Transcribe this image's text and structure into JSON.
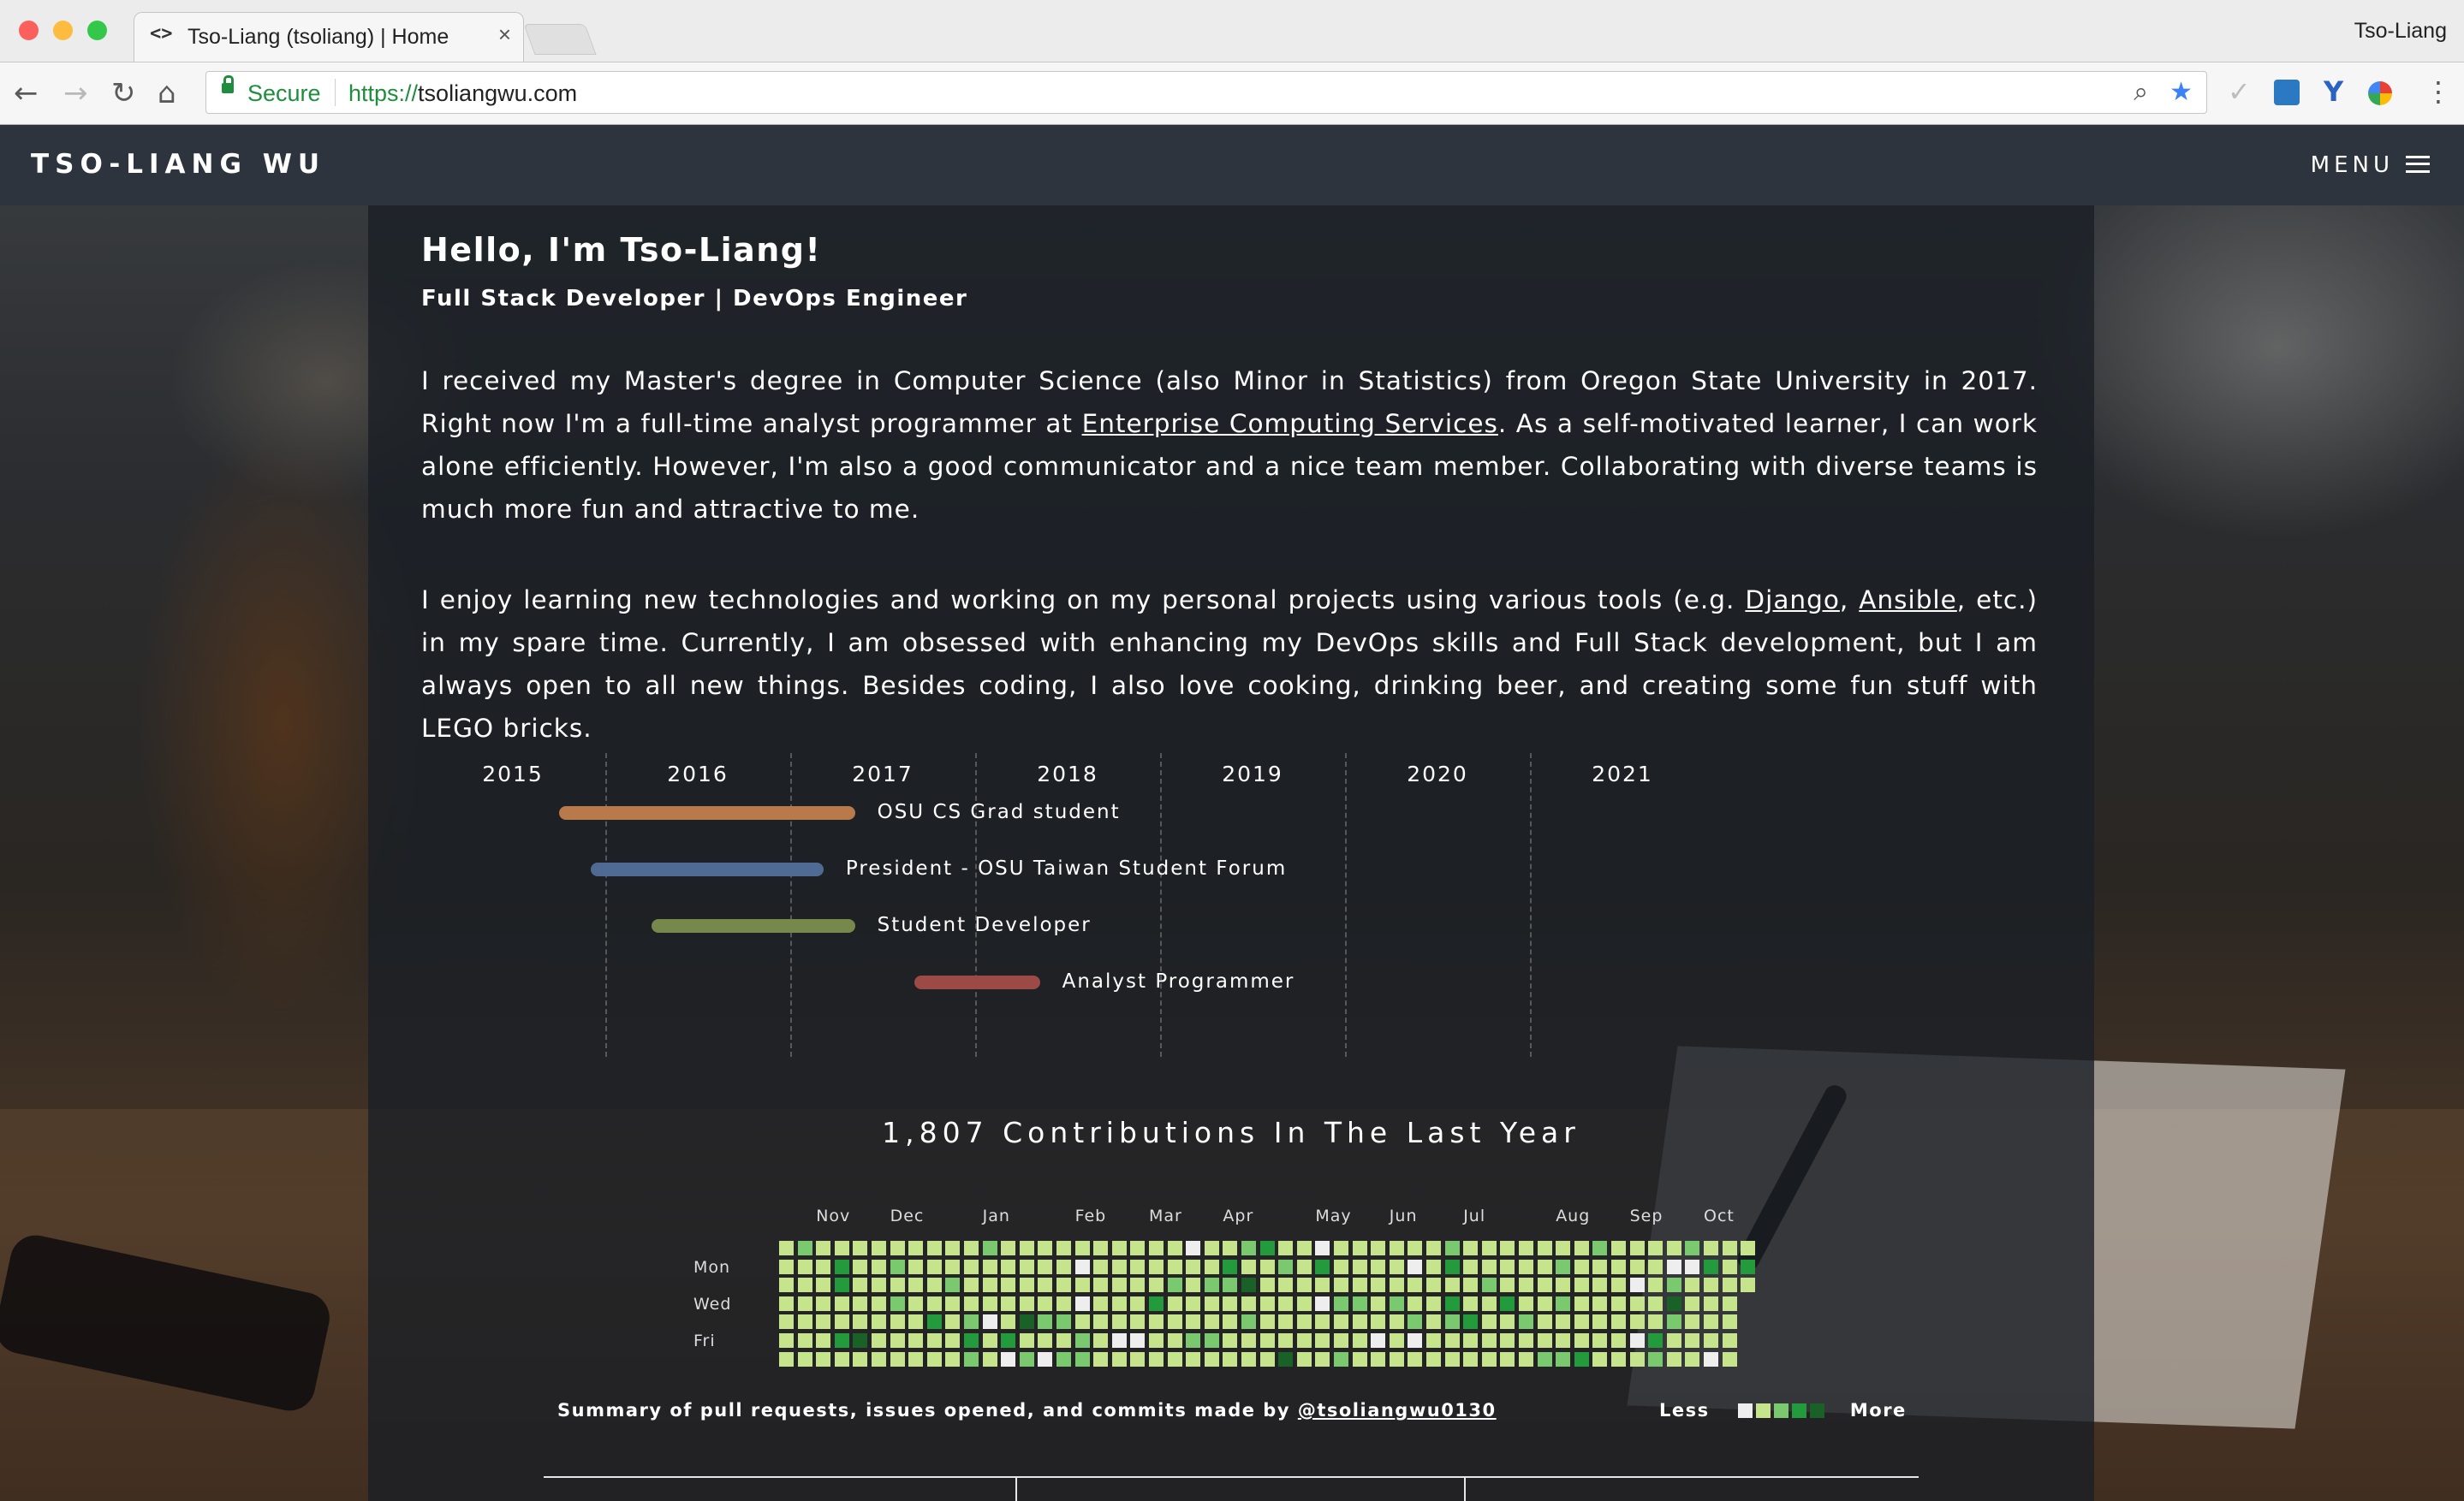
{
  "browser": {
    "tab_title": "Tso-Liang (tsoliang) | Home",
    "tab_icon": "code-icon",
    "tab_close": "×",
    "profile_name": "Tso-Liang",
    "security_label": "Secure",
    "url_scheme": "https://",
    "url_host": "tsoliangwu.com"
  },
  "site": {
    "brand": "TSO-LIANG WU",
    "menu_label": "MENU"
  },
  "hero": {
    "greeting": "Hello, I'm Tso-Liang!",
    "subtitle": "Full Stack Developer | DevOps Engineer"
  },
  "about": {
    "p1_a": "I received my Master's degree in Computer Science (also Minor in Statistics) from Oregon State University in 2017. Right now I'm a full-time analyst programmer at ",
    "p1_link": "Enterprise Computing Services",
    "p1_b": ". As a self-motivated learner, I can work alone efficiently. However, I'm also a good communicator and a nice team member. Collaborating with diverse teams is much more fun and attractive to me.",
    "p2_a": "I enjoy learning new technologies and working on my personal projects using various tools (e.g. ",
    "p2_link1": "Django",
    "p2_sep": ", ",
    "p2_link2": "Ansible",
    "p2_b": ", etc.) in my spare time. Currently, I am obsessed with enhancing my DevOps skills and Full Stack development, but I am always open to all new things. Besides coding, I also love cooking, drinking beer, and creating some fun stuff with LEGO bricks."
  },
  "timeline": {
    "years": [
      "2015",
      "2016",
      "2017",
      "2018",
      "2019",
      "2020",
      "2021"
    ],
    "items": [
      {
        "label": "OSU CS Grad student",
        "start": 2015.25,
        "end": 2016.85,
        "color": "#b87a4b"
      },
      {
        "label": "President - OSU Taiwan Student Forum",
        "start": 2015.42,
        "end": 2016.68,
        "color": "#4f6b94"
      },
      {
        "label": "Student Developer",
        "start": 2015.75,
        "end": 2016.85,
        "color": "#77884d"
      },
      {
        "label": "Analyst Programmer",
        "start": 2017.17,
        "end": 2017.85,
        "color": "#9c4a45"
      }
    ]
  },
  "contributions": {
    "title": "1,807 Contributions In The Last Year",
    "months": [
      "Nov",
      "Dec",
      "Jan",
      "Feb",
      "Mar",
      "Apr",
      "May",
      "Jun",
      "Jul",
      "Aug",
      "Sep",
      "Oct"
    ],
    "days": [
      "Mon",
      "Wed",
      "Fri"
    ],
    "summary_text": "Summary of pull requests, issues opened, and commits made by ",
    "summary_user": "@tsoliangwu0130",
    "legend_less": "Less",
    "legend_more": "More",
    "colors": [
      "#eeeeee",
      "#c6e48b",
      "#7bc96f",
      "#239a3b",
      "#196127"
    ]
  }
}
